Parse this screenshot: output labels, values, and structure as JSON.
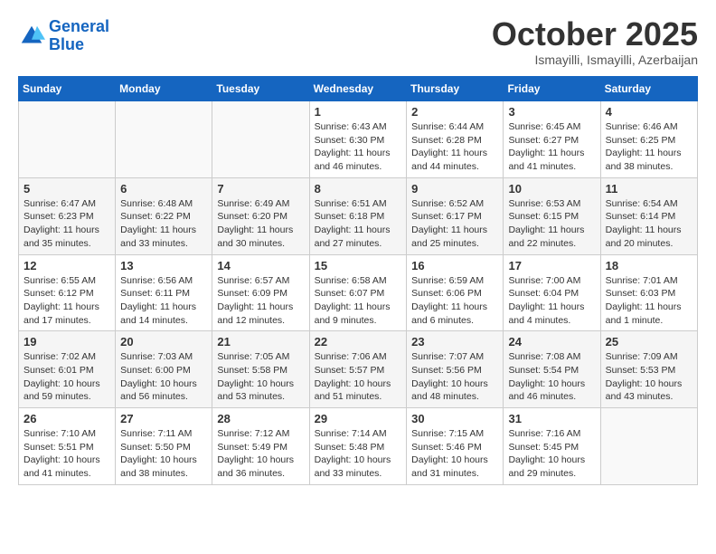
{
  "header": {
    "logo_line1": "General",
    "logo_line2": "Blue",
    "month": "October 2025",
    "location": "Ismayilli, Ismayilli, Azerbaijan"
  },
  "weekdays": [
    "Sunday",
    "Monday",
    "Tuesday",
    "Wednesday",
    "Thursday",
    "Friday",
    "Saturday"
  ],
  "weeks": [
    [
      {
        "day": "",
        "info": ""
      },
      {
        "day": "",
        "info": ""
      },
      {
        "day": "",
        "info": ""
      },
      {
        "day": "1",
        "info": "Sunrise: 6:43 AM\nSunset: 6:30 PM\nDaylight: 11 hours and 46 minutes."
      },
      {
        "day": "2",
        "info": "Sunrise: 6:44 AM\nSunset: 6:28 PM\nDaylight: 11 hours and 44 minutes."
      },
      {
        "day": "3",
        "info": "Sunrise: 6:45 AM\nSunset: 6:27 PM\nDaylight: 11 hours and 41 minutes."
      },
      {
        "day": "4",
        "info": "Sunrise: 6:46 AM\nSunset: 6:25 PM\nDaylight: 11 hours and 38 minutes."
      }
    ],
    [
      {
        "day": "5",
        "info": "Sunrise: 6:47 AM\nSunset: 6:23 PM\nDaylight: 11 hours and 35 minutes."
      },
      {
        "day": "6",
        "info": "Sunrise: 6:48 AM\nSunset: 6:22 PM\nDaylight: 11 hours and 33 minutes."
      },
      {
        "day": "7",
        "info": "Sunrise: 6:49 AM\nSunset: 6:20 PM\nDaylight: 11 hours and 30 minutes."
      },
      {
        "day": "8",
        "info": "Sunrise: 6:51 AM\nSunset: 6:18 PM\nDaylight: 11 hours and 27 minutes."
      },
      {
        "day": "9",
        "info": "Sunrise: 6:52 AM\nSunset: 6:17 PM\nDaylight: 11 hours and 25 minutes."
      },
      {
        "day": "10",
        "info": "Sunrise: 6:53 AM\nSunset: 6:15 PM\nDaylight: 11 hours and 22 minutes."
      },
      {
        "day": "11",
        "info": "Sunrise: 6:54 AM\nSunset: 6:14 PM\nDaylight: 11 hours and 20 minutes."
      }
    ],
    [
      {
        "day": "12",
        "info": "Sunrise: 6:55 AM\nSunset: 6:12 PM\nDaylight: 11 hours and 17 minutes."
      },
      {
        "day": "13",
        "info": "Sunrise: 6:56 AM\nSunset: 6:11 PM\nDaylight: 11 hours and 14 minutes."
      },
      {
        "day": "14",
        "info": "Sunrise: 6:57 AM\nSunset: 6:09 PM\nDaylight: 11 hours and 12 minutes."
      },
      {
        "day": "15",
        "info": "Sunrise: 6:58 AM\nSunset: 6:07 PM\nDaylight: 11 hours and 9 minutes."
      },
      {
        "day": "16",
        "info": "Sunrise: 6:59 AM\nSunset: 6:06 PM\nDaylight: 11 hours and 6 minutes."
      },
      {
        "day": "17",
        "info": "Sunrise: 7:00 AM\nSunset: 6:04 PM\nDaylight: 11 hours and 4 minutes."
      },
      {
        "day": "18",
        "info": "Sunrise: 7:01 AM\nSunset: 6:03 PM\nDaylight: 11 hours and 1 minute."
      }
    ],
    [
      {
        "day": "19",
        "info": "Sunrise: 7:02 AM\nSunset: 6:01 PM\nDaylight: 10 hours and 59 minutes."
      },
      {
        "day": "20",
        "info": "Sunrise: 7:03 AM\nSunset: 6:00 PM\nDaylight: 10 hours and 56 minutes."
      },
      {
        "day": "21",
        "info": "Sunrise: 7:05 AM\nSunset: 5:58 PM\nDaylight: 10 hours and 53 minutes."
      },
      {
        "day": "22",
        "info": "Sunrise: 7:06 AM\nSunset: 5:57 PM\nDaylight: 10 hours and 51 minutes."
      },
      {
        "day": "23",
        "info": "Sunrise: 7:07 AM\nSunset: 5:56 PM\nDaylight: 10 hours and 48 minutes."
      },
      {
        "day": "24",
        "info": "Sunrise: 7:08 AM\nSunset: 5:54 PM\nDaylight: 10 hours and 46 minutes."
      },
      {
        "day": "25",
        "info": "Sunrise: 7:09 AM\nSunset: 5:53 PM\nDaylight: 10 hours and 43 minutes."
      }
    ],
    [
      {
        "day": "26",
        "info": "Sunrise: 7:10 AM\nSunset: 5:51 PM\nDaylight: 10 hours and 41 minutes."
      },
      {
        "day": "27",
        "info": "Sunrise: 7:11 AM\nSunset: 5:50 PM\nDaylight: 10 hours and 38 minutes."
      },
      {
        "day": "28",
        "info": "Sunrise: 7:12 AM\nSunset: 5:49 PM\nDaylight: 10 hours and 36 minutes."
      },
      {
        "day": "29",
        "info": "Sunrise: 7:14 AM\nSunset: 5:48 PM\nDaylight: 10 hours and 33 minutes."
      },
      {
        "day": "30",
        "info": "Sunrise: 7:15 AM\nSunset: 5:46 PM\nDaylight: 10 hours and 31 minutes."
      },
      {
        "day": "31",
        "info": "Sunrise: 7:16 AM\nSunset: 5:45 PM\nDaylight: 10 hours and 29 minutes."
      },
      {
        "day": "",
        "info": ""
      }
    ]
  ]
}
